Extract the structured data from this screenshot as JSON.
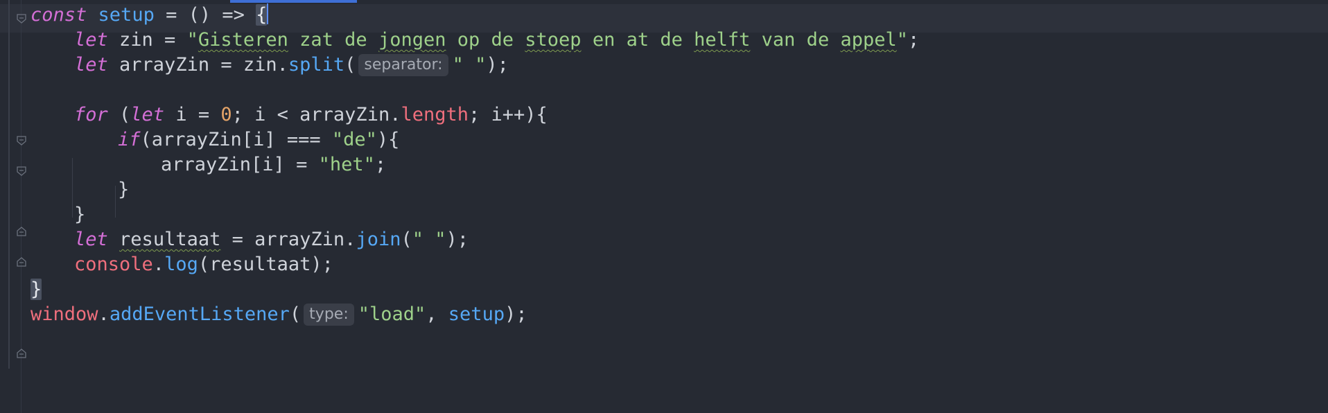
{
  "editor": {
    "language": "JavaScript",
    "theme": {
      "background": "#262a33",
      "keyword": "#d46fd6",
      "function": "#56a8f5",
      "string": "#9ed18a",
      "number": "#e5a468",
      "global": "#ef6f7d",
      "text": "#cfd3da"
    },
    "fold_icons": [
      "fold-open-icon",
      "fold-close-icon"
    ],
    "lines": [
      {
        "tokens": [
          {
            "t": "const",
            "c": "kw"
          },
          {
            "t": " ",
            "c": "plain"
          },
          {
            "t": "setup",
            "c": "fn"
          },
          {
            "t": " = () => ",
            "c": "plain"
          },
          {
            "t": "{",
            "c": "brace-hl"
          }
        ],
        "caret": true
      },
      {
        "tokens": [
          {
            "t": "let",
            "c": "kw"
          },
          {
            "t": " zin = ",
            "c": "plain"
          },
          {
            "t": "\"",
            "c": "str"
          },
          {
            "t": "Gisteren",
            "c": "str wavy"
          },
          {
            "t": " zat de ",
            "c": "str"
          },
          {
            "t": "jongen",
            "c": "str wavy"
          },
          {
            "t": " op de ",
            "c": "str"
          },
          {
            "t": "stoep",
            "c": "str wavy"
          },
          {
            "t": " en at de ",
            "c": "str"
          },
          {
            "t": "helft",
            "c": "str wavy"
          },
          {
            "t": " van de ",
            "c": "str"
          },
          {
            "t": "appel",
            "c": "str wavy"
          },
          {
            "t": "\"",
            "c": "str"
          },
          {
            "t": ";",
            "c": "plain"
          }
        ]
      },
      {
        "tokens": [
          {
            "t": "let",
            "c": "kw"
          },
          {
            "t": " arrayZin = zin.",
            "c": "plain"
          },
          {
            "t": "split",
            "c": "fn"
          },
          {
            "t": "(",
            "c": "plain"
          },
          {
            "t": "separator:",
            "c": "hint"
          },
          {
            "t": "\" \"",
            "c": "str"
          },
          {
            "t": ");",
            "c": "plain"
          }
        ]
      },
      {
        "tokens": []
      },
      {
        "tokens": [
          {
            "t": "for",
            "c": "kw"
          },
          {
            "t": " (",
            "c": "plain"
          },
          {
            "t": "let",
            "c": "kw"
          },
          {
            "t": " i = ",
            "c": "plain"
          },
          {
            "t": "0",
            "c": "num"
          },
          {
            "t": "; i < arrayZin.",
            "c": "plain"
          },
          {
            "t": "length",
            "c": "glob"
          },
          {
            "t": "; i++){",
            "c": "plain"
          }
        ]
      },
      {
        "tokens": [
          {
            "t": "if",
            "c": "kw"
          },
          {
            "t": "(arrayZin[i] === ",
            "c": "plain"
          },
          {
            "t": "\"de\"",
            "c": "str"
          },
          {
            "t": "){",
            "c": "plain"
          }
        ]
      },
      {
        "tokens": [
          {
            "t": "arrayZin[i] = ",
            "c": "plain"
          },
          {
            "t": "\"het\"",
            "c": "str"
          },
          {
            "t": ";",
            "c": "plain"
          }
        ]
      },
      {
        "tokens": [
          {
            "t": "}",
            "c": "plain"
          }
        ]
      },
      {
        "tokens": [
          {
            "t": "}",
            "c": "plain"
          }
        ]
      },
      {
        "tokens": [
          {
            "t": "let",
            "c": "kw"
          },
          {
            "t": " ",
            "c": "plain"
          },
          {
            "t": "resultaat",
            "c": "plain wavy"
          },
          {
            "t": " = arrayZin.",
            "c": "plain"
          },
          {
            "t": "join",
            "c": "fn"
          },
          {
            "t": "(",
            "c": "plain"
          },
          {
            "t": "\" \"",
            "c": "str"
          },
          {
            "t": ");",
            "c": "plain"
          }
        ]
      },
      {
        "tokens": [
          {
            "t": "console",
            "c": "glob"
          },
          {
            "t": ".",
            "c": "plain"
          },
          {
            "t": "log",
            "c": "fn"
          },
          {
            "t": "(resultaat);",
            "c": "plain"
          }
        ]
      },
      {
        "tokens": [
          {
            "t": "}",
            "c": "brace-hl"
          }
        ]
      },
      {
        "tokens": [
          {
            "t": "window",
            "c": "glob"
          },
          {
            "t": ".",
            "c": "plain"
          },
          {
            "t": "addEventListener",
            "c": "fn"
          },
          {
            "t": "(",
            "c": "plain"
          },
          {
            "t": "type:",
            "c": "hint"
          },
          {
            "t": "\"load\"",
            "c": "str"
          },
          {
            "t": ", ",
            "c": "plain"
          },
          {
            "t": "setup",
            "c": "fn"
          },
          {
            "t": ");",
            "c": "plain"
          }
        ]
      }
    ]
  }
}
